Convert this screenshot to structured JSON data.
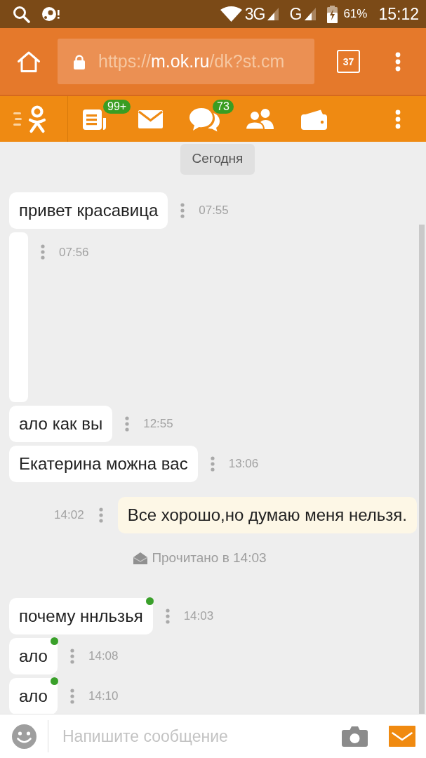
{
  "status_bar": {
    "network_primary": "3G",
    "network_secondary": "G",
    "battery": "61%",
    "time": "15:12"
  },
  "browser_bar": {
    "url": {
      "scheme": "https://",
      "host": "m.ok.ru",
      "path": "/dk?st.cm"
    },
    "tab_count": "37"
  },
  "app_toolbar": {
    "items": [
      {
        "kind": "feed",
        "badge": "99+"
      },
      {
        "kind": "mail"
      },
      {
        "kind": "discussions",
        "badge": "73"
      },
      {
        "kind": "friends"
      },
      {
        "kind": "wallet"
      }
    ]
  },
  "chat": {
    "date_divider": "Сегодня",
    "messages": [
      {
        "kind": "incoming",
        "text": "привет красавица",
        "time": "07:55",
        "unread": false
      },
      {
        "kind": "blank",
        "time": "07:56",
        "unread": false
      },
      {
        "kind": "incoming",
        "text": "ало как вы",
        "time": "12:55",
        "unread": false
      },
      {
        "kind": "incoming",
        "text": "Екатерина можна вас",
        "time": "13:06",
        "unread": false
      },
      {
        "kind": "outgoing",
        "text": "Все хорошо,но думаю меня нельзя.",
        "time": "14:02",
        "unread": false
      },
      {
        "kind": "receipt",
        "text": "Прочитано в 14:03"
      },
      {
        "kind": "incoming",
        "text": "почему ннльзья",
        "time": "14:03",
        "unread": true
      },
      {
        "kind": "incoming",
        "text": "ало",
        "time": "14:08",
        "unread": true
      },
      {
        "kind": "incoming",
        "text": "ало",
        "time": "14:10",
        "unread": true
      }
    ]
  },
  "composer": {
    "placeholder": "Напишите сообщение"
  }
}
